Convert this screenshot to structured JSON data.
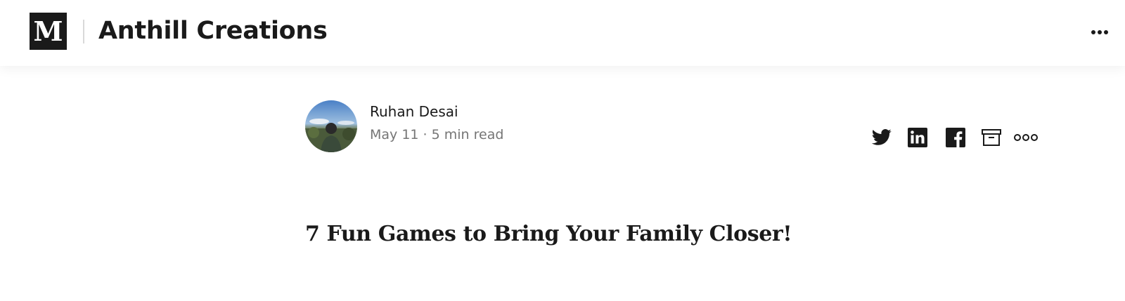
{
  "header": {
    "logo_letter": "M",
    "publication_name": "Anthill Creations",
    "more_icon": "more-horizontal-icon"
  },
  "author": {
    "name": "Ruhan Desai",
    "date": "May 11",
    "separator": "·",
    "read_time": "5 min read",
    "avatar_icon": "avatar-photo"
  },
  "share": {
    "icons": [
      "twitter-icon",
      "linkedin-icon",
      "facebook-icon",
      "bookmark-archive-icon",
      "more-options-icon"
    ]
  },
  "article": {
    "title": "7 Fun Games to Bring Your Family Closer!"
  },
  "colors": {
    "text": "#1a1a1a",
    "muted": "#757575",
    "logo_bg": "#1a1a1a"
  }
}
